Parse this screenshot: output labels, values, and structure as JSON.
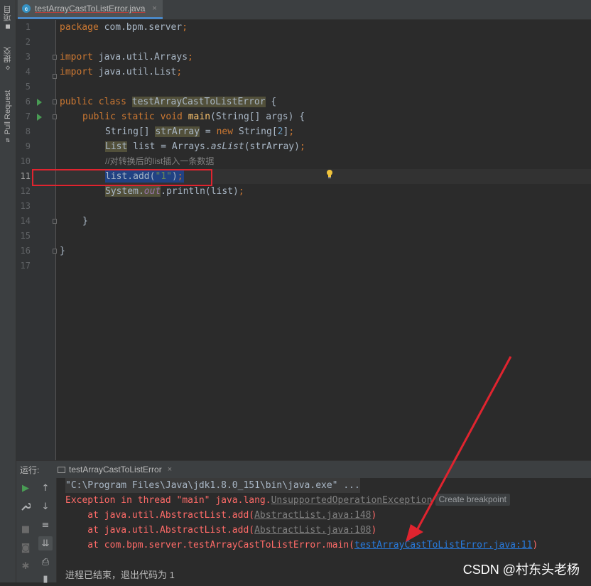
{
  "left_strip": {
    "project_tab": "项目",
    "commit_tab": "提交",
    "pull_request_tab": "Pull Request"
  },
  "editor_tab": {
    "title": "testArrayCastToListError.java",
    "close": "×",
    "file_icon": "c-class-icon"
  },
  "editor": {
    "line_numbers": [
      "1",
      "2",
      "3",
      "4",
      "5",
      "6",
      "7",
      "8",
      "9",
      "10",
      "11",
      "12",
      "13",
      "14",
      "15",
      "16",
      "17"
    ],
    "code": {
      "l1_kw": "package",
      "l1_rest": " com.bpm.server",
      "l1_semi": ";",
      "l3_kw": "import",
      "l3_rest": " java.util.Arrays",
      "l3_semi": ";",
      "l4_kw": "import",
      "l4_rest": " java.util.List",
      "l4_semi": ";",
      "l6_kw": "public class ",
      "l6_class": "testArrayCastToListError",
      "l6_rest": " {",
      "l7_kw": "public static void ",
      "l7_fn": "main",
      "l7_rest": "(String[] args) {",
      "l8_type": "String[] ",
      "l8_var": "strArray",
      "l8_eq": " = ",
      "l8_new": "new ",
      "l8_type2": "String[",
      "l8_num": "2",
      "l8_end": "]",
      "l8_semi": ";",
      "l9_type": "List",
      "l9_mid": " list = Arrays.",
      "l9_method": "asList",
      "l9_end": "(strArray)",
      "l9_semi": ";",
      "l10_comment": "//对转换后的list插入一条数据",
      "l11_a": "list.add(",
      "l11_str": "\"1\"",
      "l11_b": ")",
      "l11_semi": ";",
      "l12_sys": "System.",
      "l12_out": "out",
      "l12_rest": ".println(list)",
      "l12_semi": ";",
      "l14_brace": "}",
      "l16_brace": "}"
    }
  },
  "run_panel": {
    "label": "运行:",
    "tab_title": "testArrayCastToListError",
    "tab_close": "×",
    "console": {
      "cmd": "\"C:\\Program Files\\Java\\jdk1.8.0_151\\bin\\java.exe\" ...",
      "exception_prefix": "Exception in thread \"main\" java.lang.",
      "exception_class": "UnsupportedOperationException",
      "create_breakpoint": "Create breakpoint",
      "trace1_prefix": "    at java.util.AbstractList.add(",
      "trace1_link": "AbstractList.java:148",
      "trace1_suffix": ")",
      "trace2_prefix": "    at java.util.AbstractList.add(",
      "trace2_link": "AbstractList.java:108",
      "trace2_suffix": ")",
      "trace3_prefix": "    at com.bpm.server.testArrayCastToListError.main(",
      "trace3_link": "testArrayCastToListError.java:11",
      "trace3_suffix": ")",
      "exit_message": "进程已结束，退出代码为 1"
    }
  },
  "watermark": "CSDN @村东头老杨",
  "colors": {
    "annotation_red": "#e0242f",
    "selection": "#214283",
    "error_text": "#ff6b68",
    "link": "#287bde"
  }
}
